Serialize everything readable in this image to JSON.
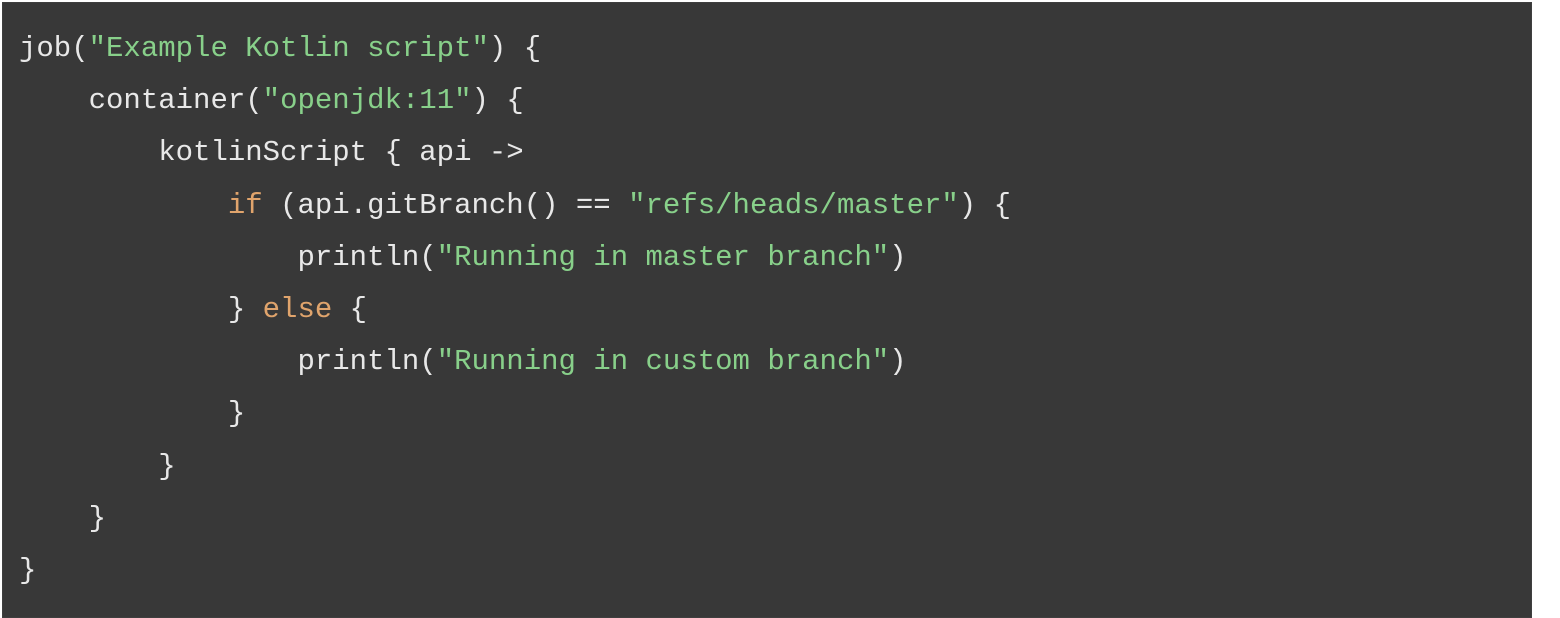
{
  "code": {
    "l1": {
      "fn": "job",
      "p1": "(",
      "str": "\"Example Kotlin script\"",
      "p2": ") {"
    },
    "l2": {
      "indent": "    ",
      "fn": "container",
      "p1": "(",
      "str": "\"openjdk:11\"",
      "p2": ") {"
    },
    "l3": {
      "indent": "        ",
      "txt": "kotlinScript { api ->"
    },
    "l4": {
      "indent": "            ",
      "kw": "if",
      "p1": " (api.gitBranch() == ",
      "str": "\"refs/heads/master\"",
      "p2": ") {"
    },
    "l5": {
      "indent": "                ",
      "fn": "println(",
      "str": "\"Running in master branch\"",
      "p2": ")"
    },
    "l6": {
      "indent": "            ",
      "p1": "} ",
      "kw": "else",
      "p2": " {"
    },
    "l7": {
      "indent": "                ",
      "fn": "println(",
      "str": "\"Running in custom branch\"",
      "p2": ")"
    },
    "l8": {
      "indent": "            ",
      "txt": "}"
    },
    "l9": {
      "indent": "        ",
      "txt": "}"
    },
    "l10": {
      "indent": "    ",
      "txt": "}"
    },
    "l11": {
      "txt": "}"
    }
  }
}
